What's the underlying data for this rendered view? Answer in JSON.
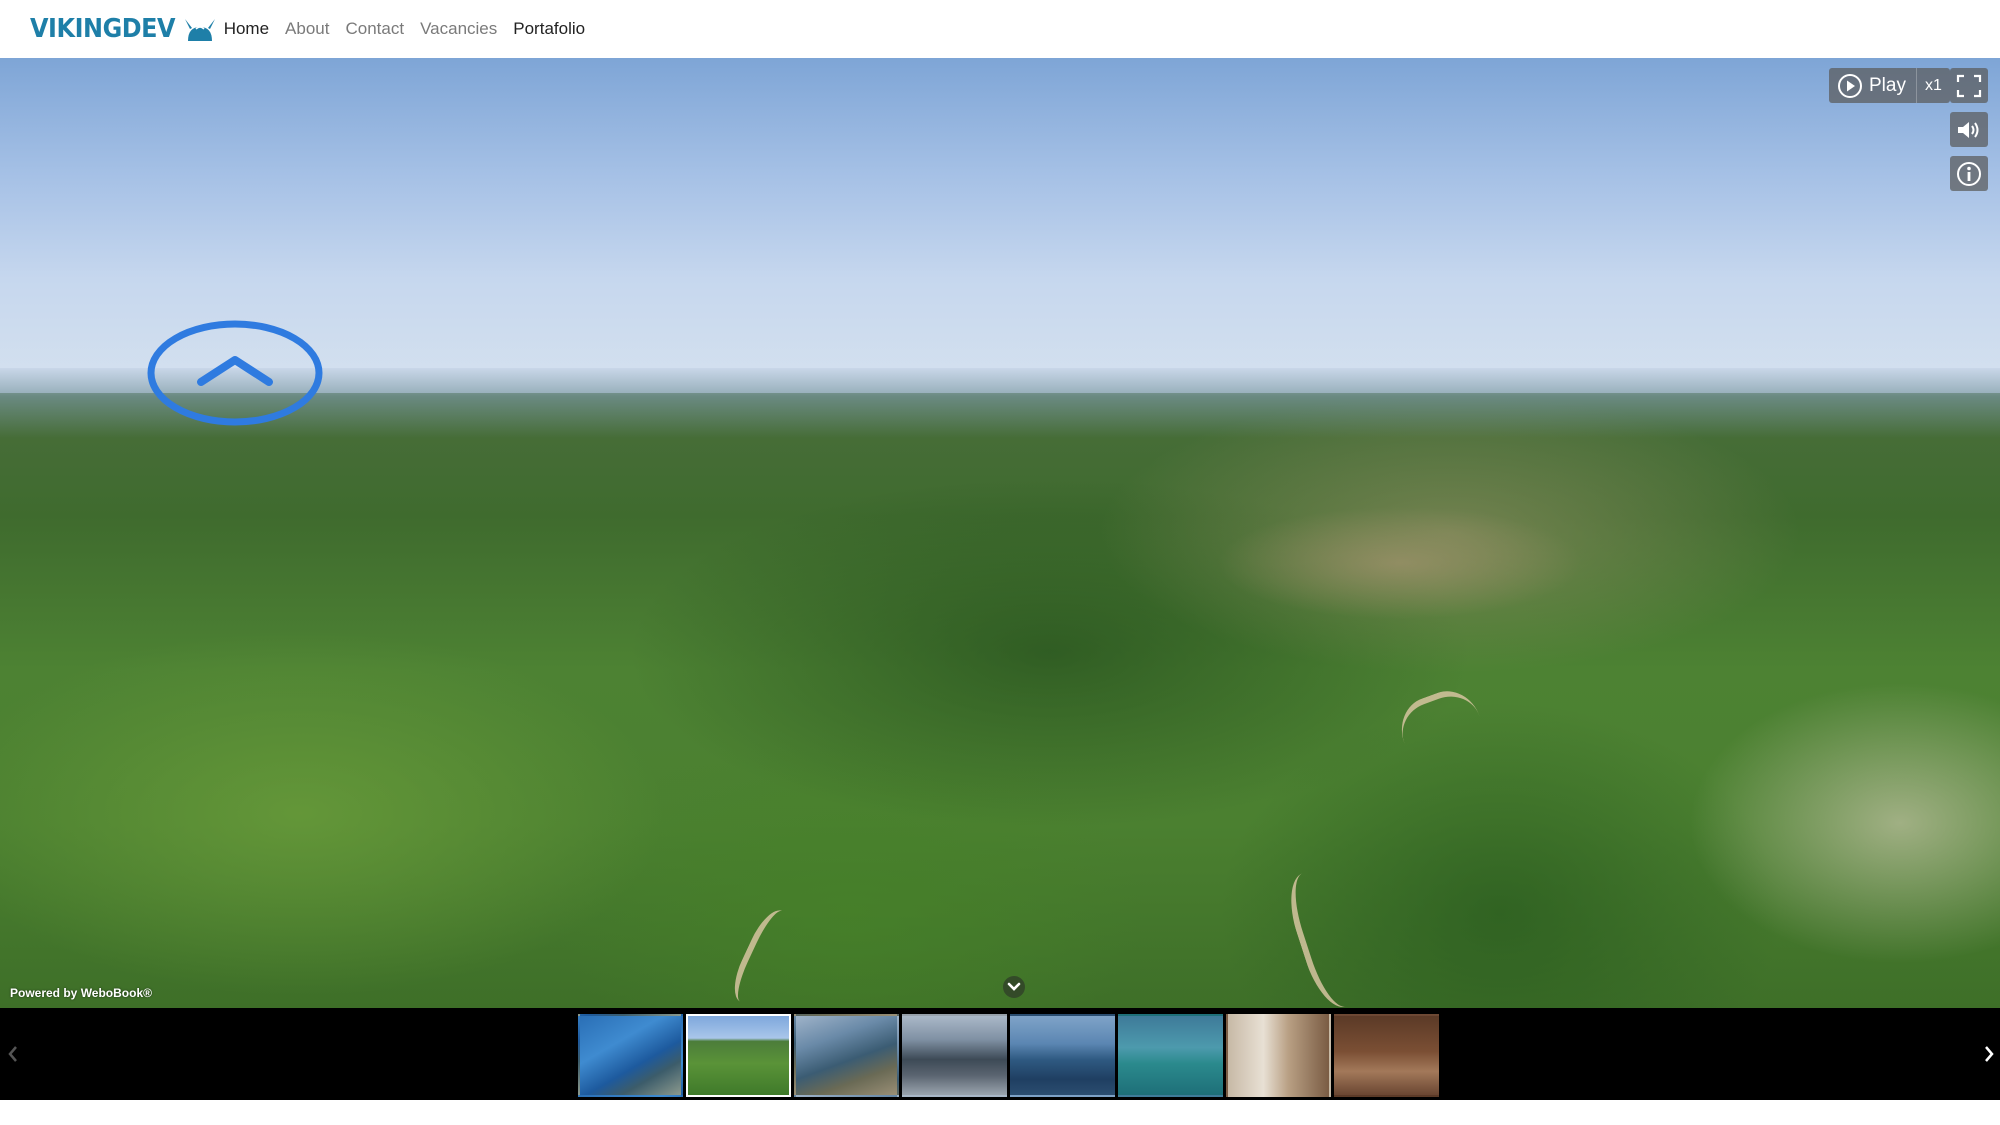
{
  "nav": {
    "brand": "VIKINGDEV",
    "links": [
      "Home",
      "About",
      "Contact",
      "Vacancies",
      "Portafolio"
    ]
  },
  "viewer": {
    "play_label": "Play",
    "speed_label": "x1",
    "powered_by": "Powered by WeboBook®",
    "hotspot_icon": "chevron-up-icon"
  },
  "thumbnails": {
    "count": 8,
    "active_index": 1
  },
  "colors": {
    "brand": "#1e7fa8",
    "hotspot": "#2f7be0",
    "control_bg": "#5a5a5a",
    "strip_bg": "#000000"
  }
}
